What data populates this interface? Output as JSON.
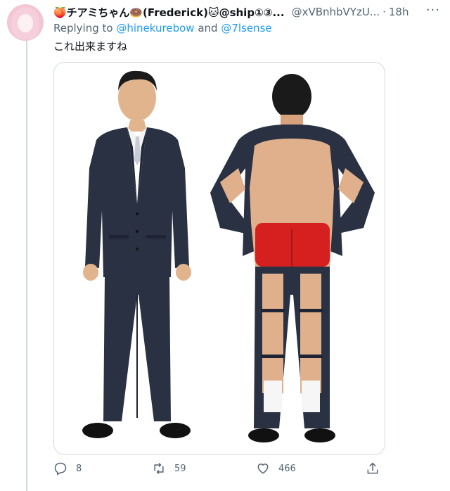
{
  "tweet": {
    "display_name": "🍑チアミちゃん🍩(Frederick)🐱@ship①③...",
    "handle": "@xVBnhbVYzU...",
    "separator": "·",
    "time": "18h",
    "more": "···",
    "reply_prefix": "Replying to",
    "reply_user_1": "@hinekurebow",
    "reply_joiner": "and",
    "reply_user_2": "@7lsense",
    "text": "これ出来ますね"
  },
  "actions": {
    "reply_count": "8",
    "retweet_count": "59",
    "like_count": "466"
  },
  "icons": [
    "reply-icon",
    "retweet-icon",
    "like-icon",
    "share-icon",
    "more-icon"
  ],
  "colors": {
    "link": "#1d9bf0",
    "muted": "#536471",
    "suit": "#2a3142",
    "red": "#d62020"
  }
}
